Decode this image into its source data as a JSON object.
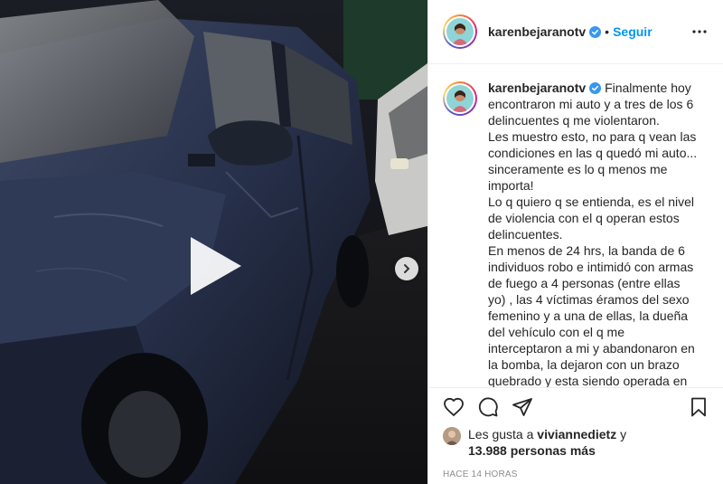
{
  "post": {
    "username": "karenbejaranotv",
    "separator": "•",
    "follow_label": "Seguir",
    "caption_lines": [
      "Finalmente hoy",
      "encontraron mi auto y a tres de los 6",
      "delincuentes q me violentaron.",
      "Les muestro esto, no para q vean las",
      "condiciones en las q quedó mi auto...",
      "sinceramente es lo q menos me",
      "importa!",
      "Lo q quiero q se entienda, es el nivel",
      "de violencia con el q operan estos",
      "delincuentes.",
      "En menos de 24 hrs, la banda de 6",
      "individuos robo e intimidó con armas",
      "de fuego a 4 personas (entre ellas",
      "yo) , las 4 víctimas éramos del sexo",
      "femenino y a una de ellas, la dueña",
      "del vehículo con el q me",
      "interceptaron a mi y abandonaron en",
      "la bomba, la dejaron con un brazo",
      "quebrado y esta siendo operada en"
    ],
    "likes": {
      "prefix": "Les gusta a",
      "liker": "viviannedietz",
      "joiner": "y",
      "others": "13.988 personas más"
    },
    "timestamp": "HACE 14 HORAS"
  },
  "icons": {
    "verified": "verified-badge-icon",
    "more": "more-options-icon",
    "like": "heart-icon",
    "comment": "comment-icon",
    "share": "paper-plane-icon",
    "save": "bookmark-icon",
    "play": "play-icon",
    "next": "chevron-right-icon"
  },
  "colors": {
    "accent": "#0095f6",
    "text": "#262626",
    "muted": "#8e8e8e",
    "border": "#efefef"
  }
}
